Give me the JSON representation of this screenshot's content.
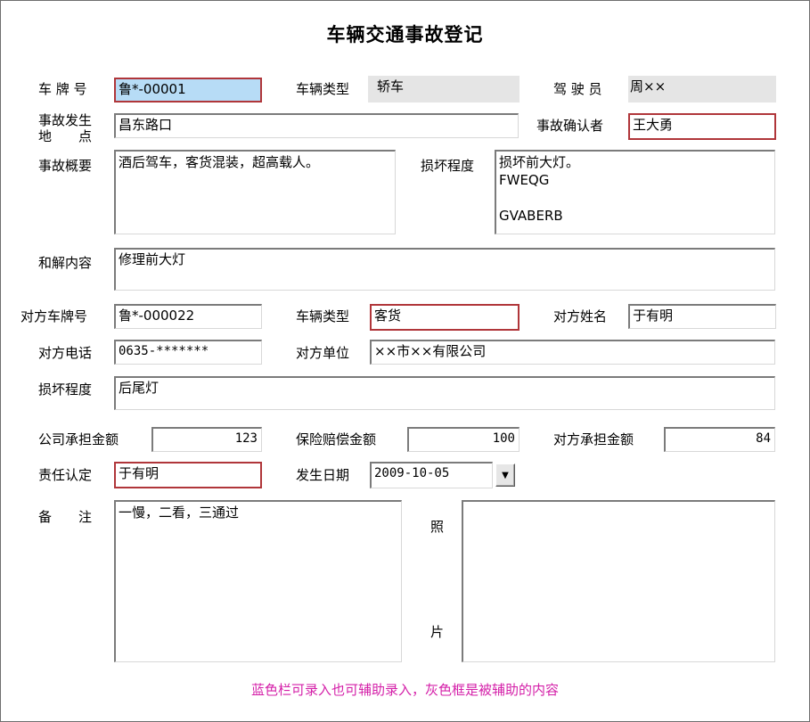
{
  "window": {
    "title": "车辆交通事故登记"
  },
  "labels": {
    "plate": "车 牌 号",
    "vehicle_type": "车辆类型",
    "driver": "驾 驶 员",
    "location_line1": "事故发生",
    "location_line2": "地　　点",
    "confirmer": "事故确认者",
    "summary": "事故概要",
    "damage": "损坏程度",
    "settlement": "和解内容",
    "other_plate": "对方车牌号",
    "other_vehicle_type": "车辆类型",
    "other_name": "对方姓名",
    "other_phone": "对方电话",
    "other_unit": "对方单位",
    "other_damage": "损坏程度",
    "company_amount": "公司承担金额",
    "insurance_amount": "保险赔偿金额",
    "other_amount": "对方承担金额",
    "responsibility": "责任认定",
    "date": "发生日期",
    "remarks": "备　　注",
    "photo_top": "照",
    "photo_bottom": "片"
  },
  "fields": {
    "plate": "鲁*-00001",
    "vehicle_type": "轿车",
    "driver": "周××",
    "location": "昌东路口",
    "confirmer": "王大勇",
    "summary": "酒后驾车，客货混装，超高载人。",
    "damage": "损坏前大灯。\nFWEQG\n\nGVABERB",
    "settlement": "修理前大灯",
    "other_plate": "鲁*-000022",
    "other_vehicle_type": "客货",
    "other_name": "于有明",
    "other_phone": "0635-*******",
    "other_unit": "××市××有限公司",
    "other_damage": "后尾灯",
    "company_amount": "123",
    "insurance_amount": "100",
    "other_amount": "84",
    "responsibility": "于有明",
    "date": "2009-10-05",
    "remarks": "一慢，二看，三通过",
    "photo": ""
  },
  "hint": "蓝色栏可录入也可辅助录入，灰色框是被辅助的内容",
  "colors": {
    "blue_field": "#b7dcf6",
    "gray_field": "#e5e5e5",
    "required_border": "#b0363a",
    "hint_text": "#d41fa8"
  },
  "icons": {
    "date_dropdown": "chevron-down-icon"
  }
}
